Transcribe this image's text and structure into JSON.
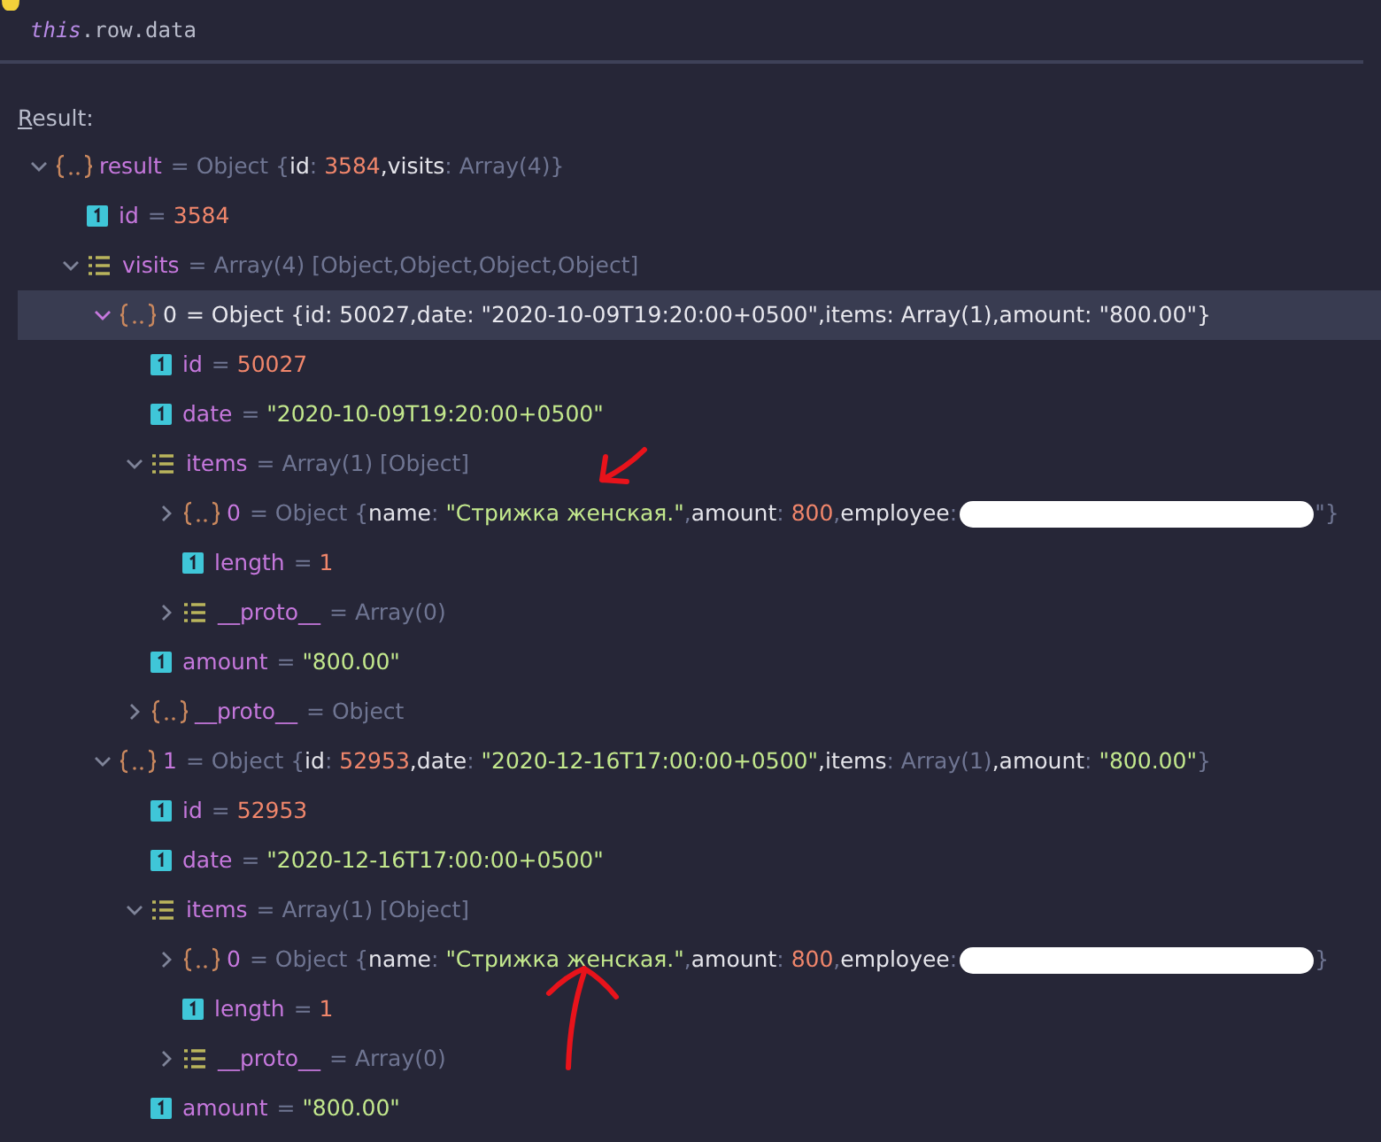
{
  "expression": [
    {
      "text": "this",
      "kind": "keyword"
    },
    {
      "text": ".row.data",
      "kind": "plain"
    }
  ],
  "result_label": "Result:",
  "tree": [
    {
      "name": "result",
      "kind": "object",
      "expanded": true,
      "selected": false,
      "value": [
        {
          "text": "= Object {",
          "kind": "type"
        },
        {
          "text": "id",
          "kind": "key"
        },
        {
          "text": ": ",
          "kind": "type"
        },
        {
          "text": "3584",
          "kind": "num"
        },
        {
          "text": ",",
          "kind": "key"
        },
        {
          "text": "visits",
          "kind": "key"
        },
        {
          "text": ": Array(4)}",
          "kind": "type"
        }
      ],
      "children": [
        {
          "name": "id",
          "kind": "primitive",
          "selected": false,
          "value": [
            {
              "text": "= ",
              "kind": "type"
            },
            {
              "text": "3584",
              "kind": "num"
            }
          ]
        },
        {
          "name": "visits",
          "kind": "array",
          "expanded": true,
          "selected": false,
          "value": [
            {
              "text": "= Array(4) [Object,Object,Object,Object]",
              "kind": "type"
            }
          ],
          "children": [
            {
              "name": "0",
              "kind": "object",
              "expanded": true,
              "selected": true,
              "value": [
                {
                  "text": "= Object {",
                  "kind": "type"
                },
                {
                  "text": "id",
                  "kind": "key"
                },
                {
                  "text": ": ",
                  "kind": "type"
                },
                {
                  "text": "50027",
                  "kind": "num"
                },
                {
                  "text": ",",
                  "kind": "key"
                },
                {
                  "text": "date",
                  "kind": "key"
                },
                {
                  "text": ": ",
                  "kind": "type"
                },
                {
                  "text": "\"2020-10-09T19:20:00+0500\"",
                  "kind": "str"
                },
                {
                  "text": ",",
                  "kind": "key"
                },
                {
                  "text": "items",
                  "kind": "key"
                },
                {
                  "text": ": Array(1)",
                  "kind": "type"
                },
                {
                  "text": ",",
                  "kind": "key"
                },
                {
                  "text": "amount",
                  "kind": "key"
                },
                {
                  "text": ": ",
                  "kind": "type"
                },
                {
                  "text": "\"800.00\"",
                  "kind": "str"
                },
                {
                  "text": "}",
                  "kind": "type"
                }
              ],
              "children": [
                {
                  "name": "id",
                  "kind": "primitive",
                  "selected": false,
                  "value": [
                    {
                      "text": "= ",
                      "kind": "type"
                    },
                    {
                      "text": "50027",
                      "kind": "num"
                    }
                  ]
                },
                {
                  "name": "date",
                  "kind": "primitive",
                  "selected": false,
                  "value": [
                    {
                      "text": "= ",
                      "kind": "type"
                    },
                    {
                      "text": "\"2020-10-09T19:20:00+0500\"",
                      "kind": "str"
                    }
                  ]
                },
                {
                  "name": "items",
                  "kind": "array",
                  "expanded": true,
                  "selected": false,
                  "value": [
                    {
                      "text": "= Array(1) [Object]",
                      "kind": "type"
                    }
                  ],
                  "children": [
                    {
                      "name": "0",
                      "kind": "object",
                      "expanded": false,
                      "selected": false,
                      "value": [
                        {
                          "text": "= Object {",
                          "kind": "type"
                        },
                        {
                          "text": "name",
                          "kind": "key"
                        },
                        {
                          "text": ": ",
                          "kind": "type"
                        },
                        {
                          "text": "\"Стрижка женская.\"",
                          "kind": "str"
                        },
                        {
                          "text": ",",
                          "kind": "type"
                        },
                        {
                          "text": "amount",
                          "kind": "key"
                        },
                        {
                          "text": ": ",
                          "kind": "type"
                        },
                        {
                          "text": "800",
                          "kind": "num"
                        },
                        {
                          "text": ",",
                          "kind": "type"
                        },
                        {
                          "text": "employee",
                          "kind": "key"
                        },
                        {
                          "text": ":",
                          "kind": "type"
                        },
                        {
                          "kind": "redacted"
                        },
                        {
                          "text": "\"}",
                          "kind": "type"
                        }
                      ]
                    },
                    {
                      "name": "length",
                      "kind": "primitive",
                      "selected": false,
                      "value": [
                        {
                          "text": "= ",
                          "kind": "type"
                        },
                        {
                          "text": "1",
                          "kind": "num"
                        }
                      ]
                    },
                    {
                      "name": "__proto__",
                      "kind": "array",
                      "expanded": false,
                      "selected": false,
                      "value": [
                        {
                          "text": "= Array(0)",
                          "kind": "type"
                        }
                      ]
                    }
                  ]
                },
                {
                  "name": "amount",
                  "kind": "primitive",
                  "selected": false,
                  "value": [
                    {
                      "text": "= ",
                      "kind": "type"
                    },
                    {
                      "text": "\"800.00\"",
                      "kind": "str"
                    }
                  ]
                },
                {
                  "name": "__proto__",
                  "kind": "object",
                  "expanded": false,
                  "selected": false,
                  "value": [
                    {
                      "text": "= Object",
                      "kind": "type"
                    }
                  ]
                }
              ]
            },
            {
              "name": "1",
              "kind": "object",
              "expanded": true,
              "selected": false,
              "value": [
                {
                  "text": "= Object {",
                  "kind": "type"
                },
                {
                  "text": "id",
                  "kind": "key"
                },
                {
                  "text": ": ",
                  "kind": "type"
                },
                {
                  "text": "52953",
                  "kind": "num"
                },
                {
                  "text": ",",
                  "kind": "key"
                },
                {
                  "text": "date",
                  "kind": "key"
                },
                {
                  "text": ": ",
                  "kind": "type"
                },
                {
                  "text": "\"2020-12-16T17:00:00+0500\"",
                  "kind": "str"
                },
                {
                  "text": ",",
                  "kind": "key"
                },
                {
                  "text": "items",
                  "kind": "key"
                },
                {
                  "text": ": Array(1)",
                  "kind": "type"
                },
                {
                  "text": ",",
                  "kind": "key"
                },
                {
                  "text": "amount",
                  "kind": "key"
                },
                {
                  "text": ": ",
                  "kind": "type"
                },
                {
                  "text": "\"800.00\"",
                  "kind": "str"
                },
                {
                  "text": "}",
                  "kind": "type"
                }
              ],
              "children": [
                {
                  "name": "id",
                  "kind": "primitive",
                  "selected": false,
                  "value": [
                    {
                      "text": "= ",
                      "kind": "type"
                    },
                    {
                      "text": "52953",
                      "kind": "num"
                    }
                  ]
                },
                {
                  "name": "date",
                  "kind": "primitive",
                  "selected": false,
                  "value": [
                    {
                      "text": "= ",
                      "kind": "type"
                    },
                    {
                      "text": "\"2020-12-16T17:00:00+0500\"",
                      "kind": "str"
                    }
                  ]
                },
                {
                  "name": "items",
                  "kind": "array",
                  "expanded": true,
                  "selected": false,
                  "value": [
                    {
                      "text": "= Array(1) [Object]",
                      "kind": "type"
                    }
                  ],
                  "children": [
                    {
                      "name": "0",
                      "kind": "object",
                      "expanded": false,
                      "selected": false,
                      "value": [
                        {
                          "text": "= Object {",
                          "kind": "type"
                        },
                        {
                          "text": "name",
                          "kind": "key"
                        },
                        {
                          "text": ": ",
                          "kind": "type"
                        },
                        {
                          "text": "\"Стрижка женская.\"",
                          "kind": "str"
                        },
                        {
                          "text": ",",
                          "kind": "type"
                        },
                        {
                          "text": "amount",
                          "kind": "key"
                        },
                        {
                          "text": ": ",
                          "kind": "type"
                        },
                        {
                          "text": "800",
                          "kind": "num"
                        },
                        {
                          "text": ",",
                          "kind": "type"
                        },
                        {
                          "text": "employee",
                          "kind": "key"
                        },
                        {
                          "text": ":",
                          "kind": "type"
                        },
                        {
                          "kind": "redacted"
                        },
                        {
                          "text": "}",
                          "kind": "type"
                        }
                      ]
                    },
                    {
                      "name": "length",
                      "kind": "primitive",
                      "selected": false,
                      "value": [
                        {
                          "text": "= ",
                          "kind": "type"
                        },
                        {
                          "text": "1",
                          "kind": "num"
                        }
                      ]
                    },
                    {
                      "name": "__proto__",
                      "kind": "array",
                      "expanded": false,
                      "selected": false,
                      "value": [
                        {
                          "text": "= Array(0)",
                          "kind": "type"
                        }
                      ]
                    }
                  ]
                },
                {
                  "name": "amount",
                  "kind": "primitive",
                  "selected": false,
                  "value": [
                    {
                      "text": "= ",
                      "kind": "type"
                    },
                    {
                      "text": "\"800.00\"",
                      "kind": "str"
                    }
                  ]
                }
              ]
            }
          ]
        }
      ]
    }
  ]
}
